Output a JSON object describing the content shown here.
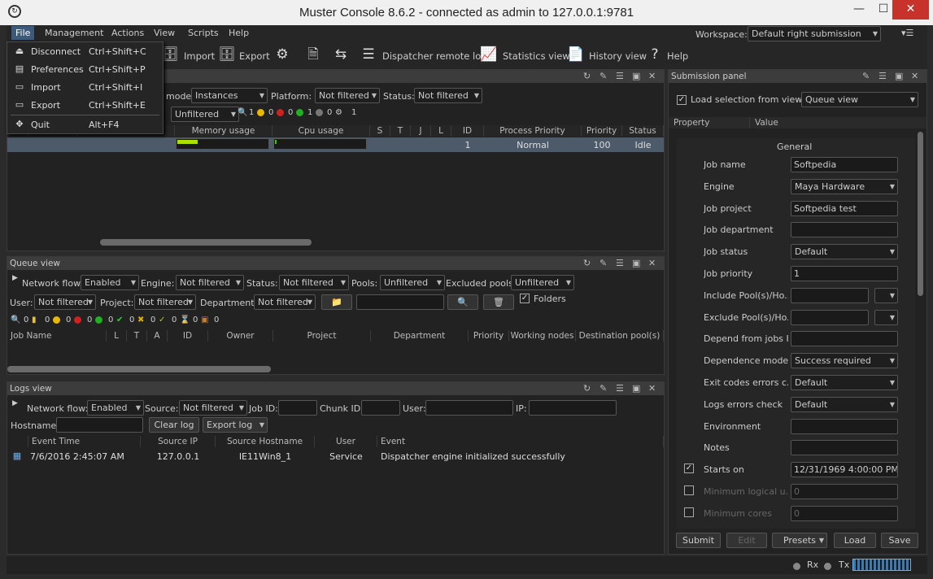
{
  "window": {
    "title": "Muster Console 8.6.2 - connected as admin to 127.0.0.1:9781",
    "min": "—",
    "max": "☐",
    "close": "✕"
  },
  "menubar": [
    "File",
    "Management",
    "Actions",
    "View",
    "Scripts",
    "Help"
  ],
  "workspace": {
    "label": "Workspace:",
    "value": "Default right submission"
  },
  "toolbar": {
    "import": "Import",
    "export": "Export",
    "dispatcher_logs": "Dispatcher remote logs",
    "statistics": "Statistics view",
    "history": "History view",
    "help": "Help"
  },
  "file_menu": [
    {
      "label": "Disconnect",
      "shortcut": "Ctrl+Shift+C"
    },
    {
      "label": "Preferences",
      "shortcut": "Ctrl+Shift+P"
    },
    {
      "label": "Import",
      "shortcut": "Ctrl+Shift+I"
    },
    {
      "label": "Export",
      "shortcut": "Ctrl+Shift+E"
    },
    {
      "label": "Quit",
      "shortcut": "Alt+F4"
    }
  ],
  "instances_panel": {
    "mode_label": "mode:",
    "mode_value": "Instances",
    "platform_label": "Platform:",
    "platform_value": "Not filtered",
    "status_label": "Status:",
    "status_value": "Not filtered",
    "unfiltered": "Unfiltered",
    "counts": [
      "1",
      "0",
      "0",
      "1",
      "0",
      "1"
    ],
    "columns": [
      "Memory usage",
      "Cpu usage",
      "S",
      "T",
      "J",
      "L",
      "ID",
      "Process Priority",
      "Priority",
      "Status"
    ],
    "row": {
      "id": "1",
      "process_priority": "Normal",
      "priority": "100",
      "status": "Idle"
    },
    "memory_fill": 0.11,
    "cpu_fill": 0.02
  },
  "queue_view": {
    "title": "Queue view",
    "network_flow_label": "Network flow:",
    "network_flow": "Enabled",
    "engine_label": "Engine:",
    "engine": "Not filtered",
    "status_label": "Status:",
    "status": "Not filtered",
    "pools_label": "Pools:",
    "pools": "Unfiltered",
    "excluded_label": "Excluded pools:",
    "excluded": "Unfiltered",
    "user_label": "User:",
    "user": "Not filtered",
    "project_label": "Project:",
    "project": "Not filtered",
    "department_label": "Department:",
    "department": "Not filtered",
    "folders": "Folders",
    "counts": [
      "0",
      "0",
      "0",
      "0",
      "0",
      "0",
      "0",
      "0",
      "0",
      "0"
    ],
    "columns": [
      "Job Name",
      "L",
      "T",
      "A",
      "ID",
      "Owner",
      "Project",
      "Department",
      "Priority",
      "Working nodes",
      "Destination pool(s)"
    ]
  },
  "logs_view": {
    "title": "Logs view",
    "network_flow_label": "Network flow:",
    "network_flow": "Enabled",
    "source_label": "Source:",
    "source": "Not filtered",
    "jobid_label": "Job ID:",
    "chunkid_label": "Chunk ID:",
    "user_label": "User:",
    "ip_label": "IP:",
    "hostname_label": "Hostname:",
    "clear": "Clear log",
    "export": "Export log",
    "columns": [
      "Event Time",
      "Source IP",
      "Source Hostname",
      "User",
      "Event"
    ],
    "rows": [
      {
        "time": "7/6/2016 2:45:07 AM",
        "ip": "127.0.0.1",
        "host": "IE11Win8_1",
        "user": "Service",
        "event": "Dispatcher engine initialized successfully"
      }
    ]
  },
  "submission": {
    "title": "Submission panel",
    "load_selection": "Load selection from view",
    "view": "Queue view",
    "property_col": "Property",
    "value_col": "Value",
    "group": "General",
    "props": [
      {
        "name": "Job name",
        "value": "Softpedia",
        "type": "text"
      },
      {
        "name": "Engine",
        "value": "Maya Hardware",
        "type": "combo"
      },
      {
        "name": "Job project",
        "value": "Softpedia test",
        "type": "text"
      },
      {
        "name": "Job department",
        "value": "",
        "type": "text"
      },
      {
        "name": "Job status",
        "value": "Default",
        "type": "combo"
      },
      {
        "name": "Job priority",
        "value": "1",
        "type": "text"
      },
      {
        "name": "Include Pool(s)/Ho...",
        "value": "",
        "type": "pool"
      },
      {
        "name": "Exclude Pool(s)/Ho...",
        "value": "",
        "type": "pool"
      },
      {
        "name": "Depend from jobs I...",
        "value": "",
        "type": "text"
      },
      {
        "name": "Dependence mode",
        "value": "Success required",
        "type": "combo"
      },
      {
        "name": "Exit codes errors c...",
        "value": "Default",
        "type": "combo"
      },
      {
        "name": "Logs errors check",
        "value": "Default",
        "type": "combo"
      },
      {
        "name": "Environment",
        "value": "",
        "type": "text"
      },
      {
        "name": "Notes",
        "value": "",
        "type": "text"
      },
      {
        "name": "Starts on",
        "value": "12/31/1969 4:00:00 PM",
        "type": "spin"
      },
      {
        "name": "Minimum logical u...",
        "value": "0",
        "type": "text"
      },
      {
        "name": "Minimum cores",
        "value": "0",
        "type": "text"
      }
    ],
    "buttons": {
      "submit": "Submit",
      "edit": "Edit",
      "presets": "Presets",
      "load": "Load",
      "save": "Save"
    }
  },
  "statusbar": {
    "rx": "Rx",
    "tx": "Tx"
  }
}
